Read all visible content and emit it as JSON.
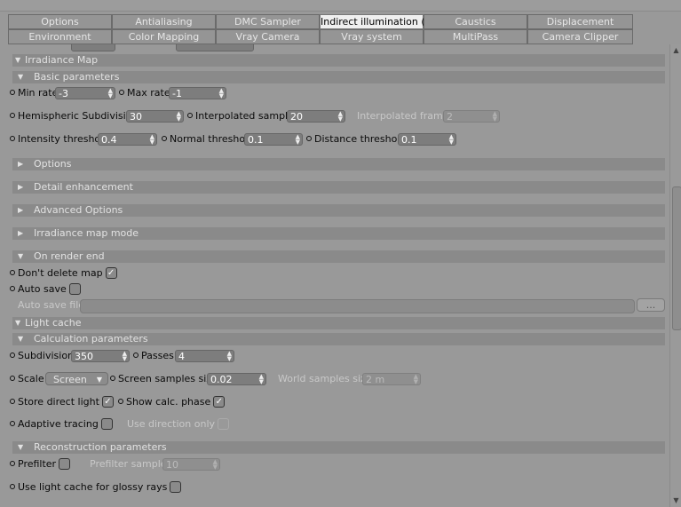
{
  "tabs": {
    "row1": [
      "Options",
      "Antialiasing",
      "DMC Sampler",
      "Indirect illumination (GI)",
      "Caustics",
      "Displacement"
    ],
    "row2": [
      "Environment",
      "Color Mapping",
      "Vray Camera",
      "Vray system",
      "MultiPass",
      "Camera Clipper"
    ],
    "active": "Indirect illumination (GI)"
  },
  "irradiance": {
    "title": "Irradiance Map",
    "basic_title": "Basic parameters",
    "min_rate_label": "Min rate",
    "min_rate_value": "-3",
    "max_rate_label": "Max rate",
    "max_rate_value": "-1",
    "hemi_label": "Hemispheric Subdivision",
    "hemi_value": "30",
    "interp_samples_label": "Interpolated samples",
    "interp_samples_value": "20",
    "interp_frames_label": "Interpolated frames",
    "interp_frames_value": "2",
    "intensity_label": "Intensity threshold",
    "intensity_value": "0.4",
    "normal_label": "Normal threshold",
    "normal_value": "0.1",
    "distance_label": "Distance threshold",
    "distance_value": "0.1",
    "options_title": "Options",
    "detail_title": "Detail enhancement",
    "advanced_title": "Advanced Options",
    "mode_title": "Irradiance map mode",
    "render_end_title": "On render end",
    "dont_delete_label": "Don't delete map",
    "dont_delete_checked": true,
    "auto_save_label": "Auto save",
    "auto_save_checked": false,
    "auto_save_file_label": "Auto save file",
    "auto_save_file_value": "",
    "browse_label": "..."
  },
  "light_cache": {
    "title": "Light cache",
    "calc_title": "Calculation parameters",
    "subdivision_label": "Subdivision",
    "subdivision_value": "350",
    "passes_label": "Passes",
    "passes_value": "4",
    "scale_label": "Scale",
    "scale_value": "Screen",
    "screen_samples_label": "Screen samples size",
    "screen_samples_value": "0.02",
    "world_samples_label": "World samples size",
    "world_samples_value": "2 m",
    "store_direct_label": "Store direct light",
    "store_direct_checked": true,
    "show_calc_label": "Show calc. phase",
    "show_calc_checked": true,
    "adaptive_label": "Adaptive tracing",
    "adaptive_checked": false,
    "use_direction_label": "Use direction only",
    "use_direction_checked": false,
    "recon_title": "Reconstruction parameters",
    "prefilter_label": "Prefilter",
    "prefilter_checked": false,
    "prefilter_samples_label": "Prefilter samples",
    "prefilter_samples_value": "10",
    "glossy_label": "Use light cache for glossy rays",
    "glossy_checked": false
  },
  "icons": {
    "expanded": "triangle-down",
    "collapsed": "triangle-right",
    "checkmark": "✓"
  }
}
